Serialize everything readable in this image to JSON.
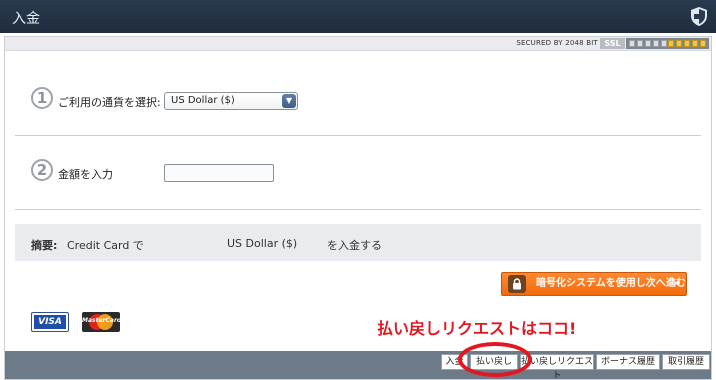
{
  "window": {
    "title": "入金"
  },
  "security": {
    "secured_text": "SECURED BY 2048 BIT",
    "ssl_label": "SSL",
    "meter_level": 5,
    "meter_total": 10
  },
  "step1": {
    "number": "1",
    "label": "ご利用の通貨を選択:",
    "currency_selected": "US Dollar ($)"
  },
  "step2": {
    "number": "2",
    "label": "金額を入力",
    "amount_value": ""
  },
  "summary": {
    "label": "摘要:",
    "method": "Credit Card で",
    "currency": "US Dollar ($)",
    "action": "を入金する"
  },
  "deposit_button": {
    "label": "暗号化システムを使用し次へ進む",
    "arrow": "»"
  },
  "cards": {
    "visa": "VISA",
    "mastercard": "MasterCard"
  },
  "annotation": {
    "text": "払い戻しリクエストはココ!"
  },
  "tabs": [
    {
      "label": "入金"
    },
    {
      "label": "払い戻し"
    },
    {
      "label": "払い戻しリクエスト"
    },
    {
      "label": "ボーナス履歴"
    },
    {
      "label": "取引履歴"
    }
  ],
  "colors": {
    "title_bar": "#1e2c3d",
    "accent_orange": "#f26a0c",
    "annotation_red": "#e3171f",
    "tab_bar": "#6d7a88"
  },
  "icons": [
    "shield-icon",
    "lock-icon",
    "chevron-down-icon",
    "visa-logo",
    "mastercard-logo"
  ]
}
